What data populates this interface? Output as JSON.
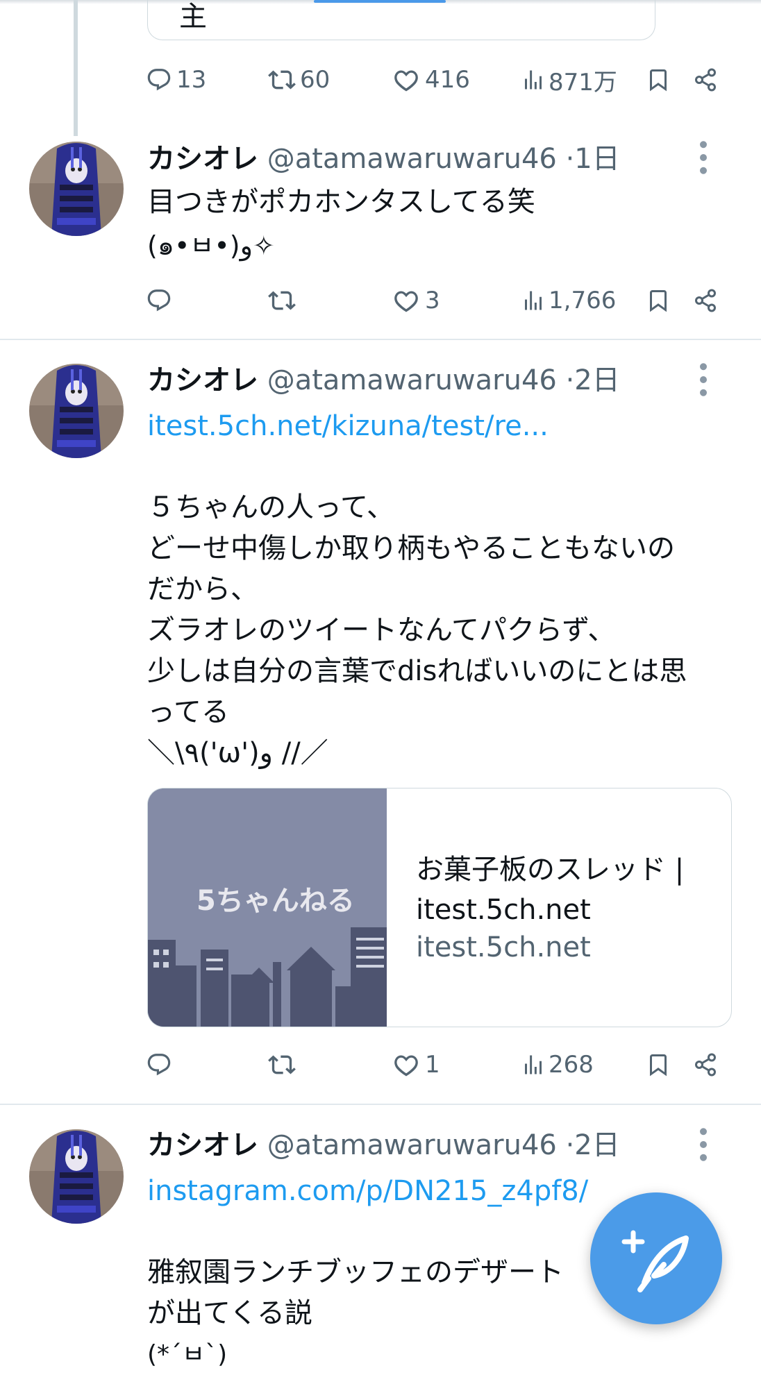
{
  "quoted": {
    "fragment": "主"
  },
  "post0": {
    "replies": "13",
    "reposts": "60",
    "likes": "416",
    "views": "871万"
  },
  "posts": [
    {
      "name": "カシオレ",
      "handle": "@atamawaruwaru46",
      "time": "1日",
      "lines": [
        "目つきがポカホンタスしてる笑",
        "(๑•ㅂ•)و✧"
      ],
      "replies": "",
      "reposts": "",
      "likes": "3",
      "views": "1,766"
    },
    {
      "name": "カシオレ",
      "handle": "@atamawaruwaru46",
      "time": "2日",
      "link": "itest.5ch.net/kizuna/test/re...",
      "lines": [
        "５ちゃんの人って、",
        "どーせ中傷しか取り柄もやることもないの",
        "だから、",
        "ズラオレのツイートなんてパクらず、",
        "少しは自分の言葉でdisればいいのにとは思",
        "ってる",
        "＼\\٩('ω')و //／"
      ],
      "card": {
        "image_logo": "5ちゃんねる",
        "title_line1": "お菓子板のスレッド |",
        "title_line2": "itest.5ch.net",
        "domain": "itest.5ch.net"
      },
      "replies": "",
      "reposts": "",
      "likes": "1",
      "views": "268"
    },
    {
      "name": "カシオレ",
      "handle": "@atamawaruwaru46",
      "time": "2日",
      "link": "instagram.com/p/DN215_z4pf8/",
      "lines": [
        "雅叙園ランチブッフェのデザート",
        "が出てくる説",
        "(*´ㅂ`)"
      ]
    }
  ],
  "colors": {
    "accent": "#1d9bf0",
    "secondary_text": "#536471",
    "divider": "#e1e8ed",
    "fab": "#4b9be8"
  },
  "icons": [
    "reply-icon",
    "repost-icon",
    "like-icon",
    "views-icon",
    "bookmark-icon",
    "share-icon",
    "more-icon",
    "compose-icon"
  ]
}
